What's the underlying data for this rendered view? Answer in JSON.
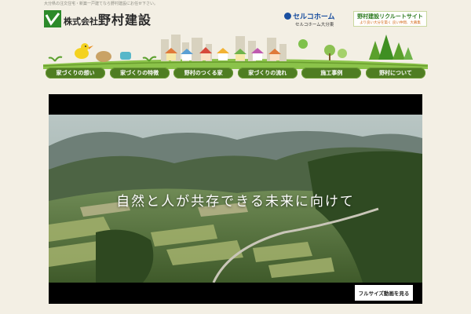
{
  "header": {
    "tagline": "大分県の注文住宅・新築一戸建てなら野村建設にお任せ下さい。",
    "company_prefix": "株式会社",
    "company_name": "野村建設",
    "sekisui_name": "セルコホーム",
    "sekisui_branch": "セルコホーム大分東",
    "recruit_title": "野村建設リクルートサイト",
    "recruit_sub": "より良い大分を築く 良い仲間、大募集"
  },
  "nav": {
    "items": [
      {
        "label": "家づくりの想い"
      },
      {
        "label": "家づくりの特徴"
      },
      {
        "label": "野村のつくる家"
      },
      {
        "label": "家づくりの流れ"
      },
      {
        "label": "施工事例"
      },
      {
        "label": "野村について"
      }
    ]
  },
  "hero": {
    "headline": "自然と人が共存できる未来に向けて",
    "fullsize_button": "フルサイズ動画を見る"
  },
  "colors": {
    "nav_green": "#4f7d22",
    "background": "#f3efe4",
    "brand_green": "#2c7a1e",
    "sekisui_blue": "#1a4fa0"
  }
}
